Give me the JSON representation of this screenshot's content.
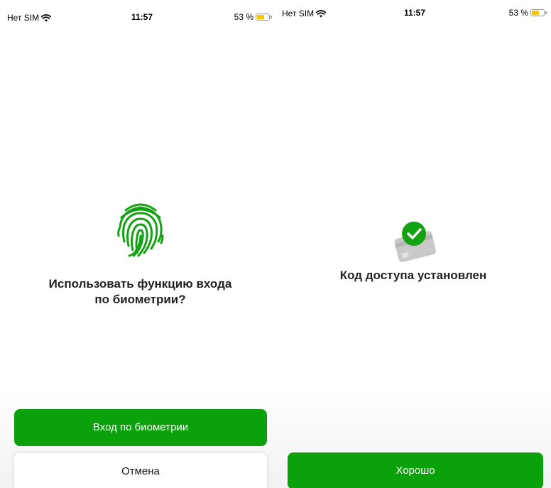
{
  "left_screen": {
    "status": {
      "carrier": "Нет SIM",
      "time": "11:57",
      "battery": "53 %",
      "battery_level": 0.53
    },
    "icon": "fingerprint-icon",
    "title_line1": "Использовать функцию входа",
    "title_line2": "по биометрии?",
    "primary_button": "Вход по биометрии",
    "secondary_button": "Отмена"
  },
  "right_screen": {
    "status": {
      "carrier": "Нет SIM",
      "time": "11:57",
      "battery": "53 %",
      "battery_level": 0.53
    },
    "icon": "card-check-icon",
    "title": "Код доступа установлен",
    "primary_button": "Хорошо"
  },
  "colors": {
    "accent_green": "#0aa10b",
    "battery_yellow": "#f7c600"
  }
}
